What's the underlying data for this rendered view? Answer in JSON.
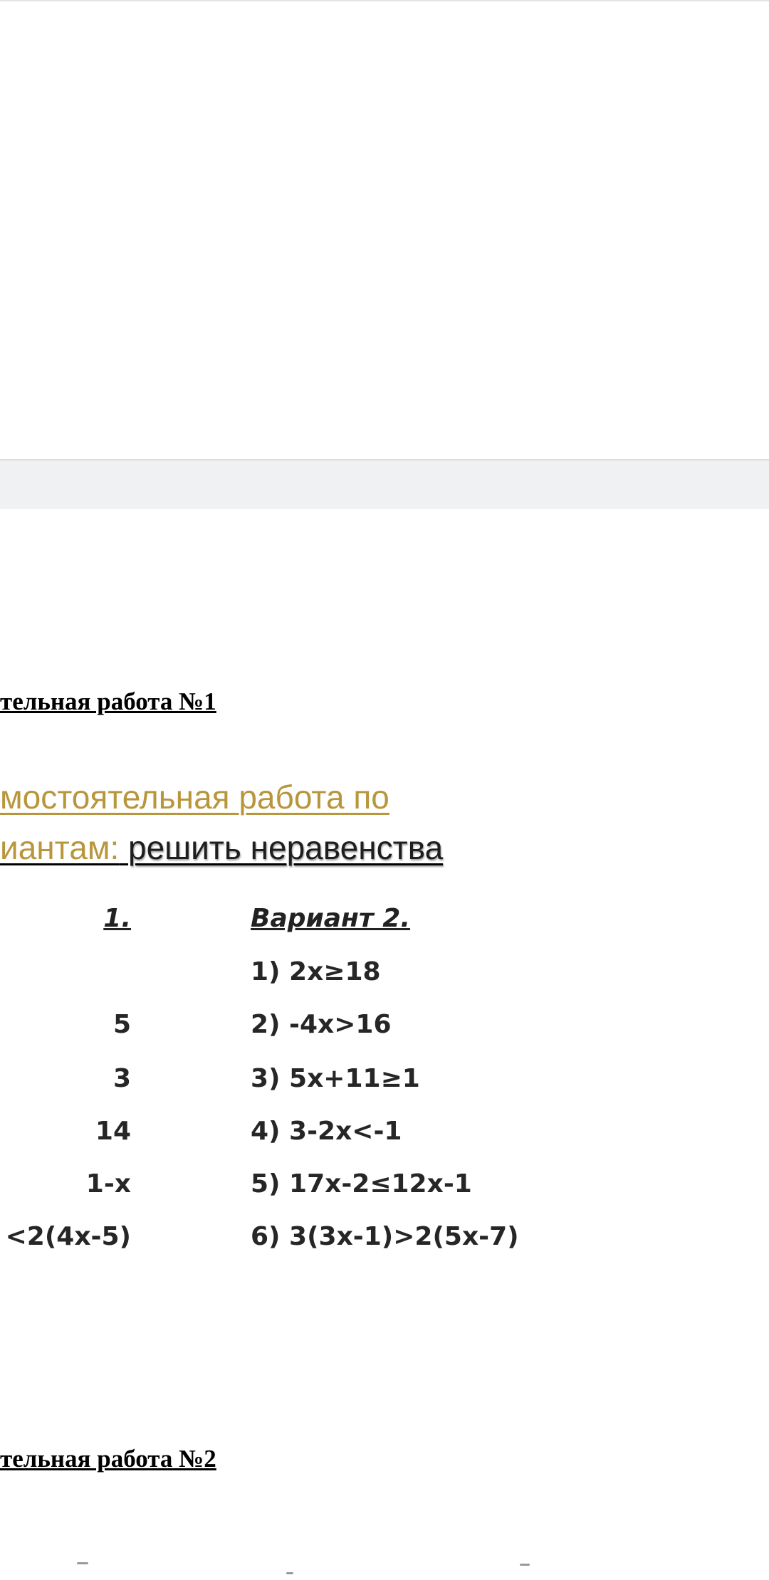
{
  "doc": {
    "heading1": "тельная работа №1",
    "task_line1": "мостоятельная работа по",
    "task_line2_gold": "иантам:",
    "task_line2_dark": "решить неравенства",
    "variant1": {
      "title": "1.",
      "items": [
        "",
        "5",
        "3",
        "14",
        "1-x",
        "<2(4x-5)"
      ]
    },
    "variant2": {
      "title": "Вариант 2.",
      "items": [
        "1) 2x≥18",
        "2) -4x>16",
        "3) 5x+11≥1",
        "4) 3-2x<-1",
        "5) 17x-2≤12x-1",
        "6) 3(3x-1)>2(5x-7)"
      ]
    },
    "heading2": "тельная работа №2"
  }
}
